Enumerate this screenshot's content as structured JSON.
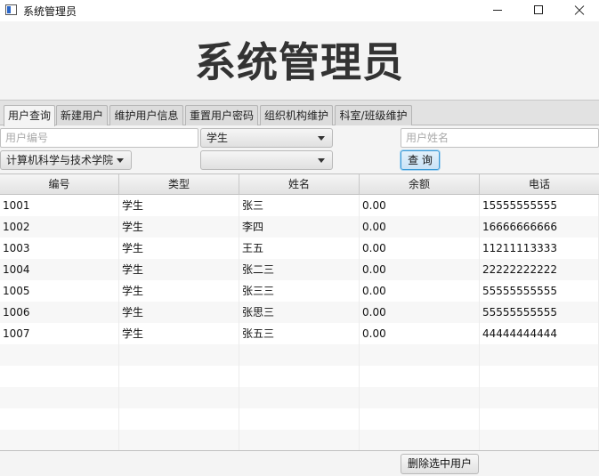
{
  "window": {
    "title": "系统管理员"
  },
  "header": {
    "title": "系统管理员"
  },
  "tabs": [
    {
      "label": "用户查询",
      "active": true
    },
    {
      "label": "新建用户",
      "active": false
    },
    {
      "label": "维护用户信息",
      "active": false
    },
    {
      "label": "重置用户密码",
      "active": false
    },
    {
      "label": "组织机构维护",
      "active": false
    },
    {
      "label": "科室/班级维护",
      "active": false
    }
  ],
  "search": {
    "user_id_placeholder": "用户编号",
    "type_selected": "学生",
    "user_name_placeholder": "用户姓名",
    "department_selected": "计算机科学与技术学院",
    "class_selected": "",
    "query_button": "查 询"
  },
  "table": {
    "columns": [
      "编号",
      "类型",
      "姓名",
      "余额",
      "电话"
    ],
    "rows": [
      [
        "1001",
        "学生",
        "张三",
        "0.00",
        "15555555555"
      ],
      [
        "1002",
        "学生",
        "李四",
        "0.00",
        "16666666666"
      ],
      [
        "1003",
        "学生",
        "王五",
        "0.00",
        "11211113333"
      ],
      [
        "1004",
        "学生",
        "张二三",
        "0.00",
        "22222222222"
      ],
      [
        "1005",
        "学生",
        "张三三",
        "0.00",
        "55555555555"
      ],
      [
        "1006",
        "学生",
        "张思三",
        "0.00",
        "55555555555"
      ],
      [
        "1007",
        "学生",
        "张五三",
        "0.00",
        "44444444444"
      ]
    ]
  },
  "footer": {
    "delete_button": "删除选中用户"
  }
}
